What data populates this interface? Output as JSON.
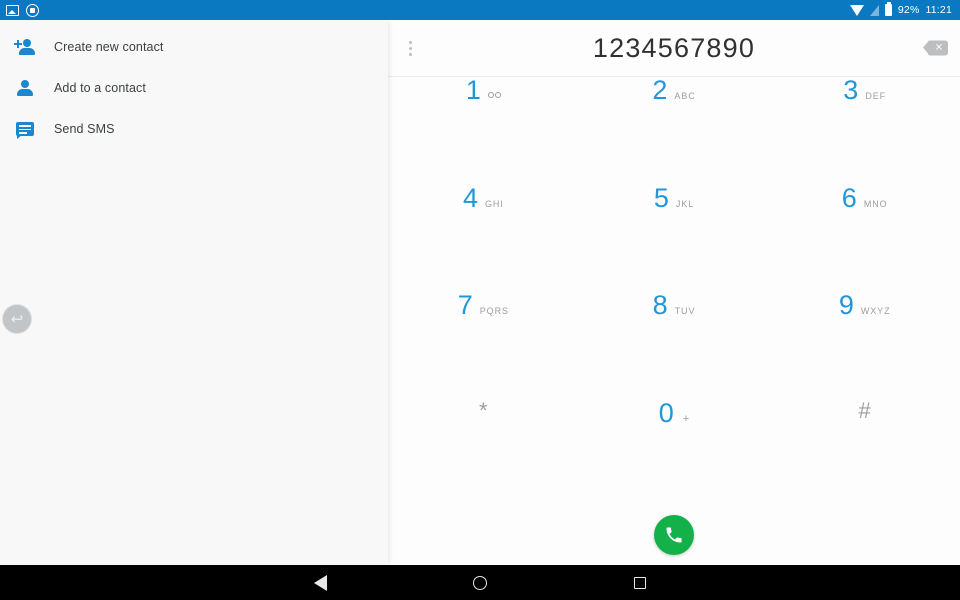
{
  "status_bar": {
    "notifications": [
      {
        "icon": "screenshot-image-icon"
      },
      {
        "icon": "app-circle-icon"
      }
    ],
    "wifi_icon": "wifi-icon",
    "signal_icon": "signal-off-icon",
    "battery_icon": "battery-icon",
    "battery_label": "92%",
    "time": "11:21",
    "background_color": "#0b79c1"
  },
  "sidebar": {
    "items": [
      {
        "label": "Create new contact",
        "icon": "person-add-icon"
      },
      {
        "label": "Add to a contact",
        "icon": "person-icon"
      },
      {
        "label": "Send SMS",
        "icon": "message-icon"
      }
    ],
    "back_fab": {
      "icon": "back-arrow-icon",
      "glyph": "↩"
    }
  },
  "dialer": {
    "overflow_menu_icon": "overflow-menu-icon",
    "number": "1234567890",
    "backspace_icon": "backspace-icon",
    "backspace_glyph": "✕",
    "keys": [
      {
        "digit": "1",
        "letters": "",
        "voicemail": true
      },
      {
        "digit": "2",
        "letters": "ABC"
      },
      {
        "digit": "3",
        "letters": "DEF"
      },
      {
        "digit": "4",
        "letters": "GHI"
      },
      {
        "digit": "5",
        "letters": "JKL"
      },
      {
        "digit": "6",
        "letters": "MNO"
      },
      {
        "digit": "7",
        "letters": "PQRS"
      },
      {
        "digit": "8",
        "letters": "TUV"
      },
      {
        "digit": "9",
        "letters": "WXYZ"
      },
      {
        "digit": "*",
        "letters": "",
        "grey": true
      },
      {
        "digit": "0",
        "letters": "",
        "plus": "+"
      },
      {
        "digit": "#",
        "letters": "",
        "grey": true
      }
    ],
    "call_button": {
      "icon": "phone-call-icon",
      "color": "#14b14b"
    },
    "digit_color": "#2196d8",
    "letters_color": "#9e9e9e"
  },
  "nav_bar": {
    "back": "nav-back-icon",
    "home": "nav-home-icon",
    "recents": "nav-recents-icon"
  }
}
